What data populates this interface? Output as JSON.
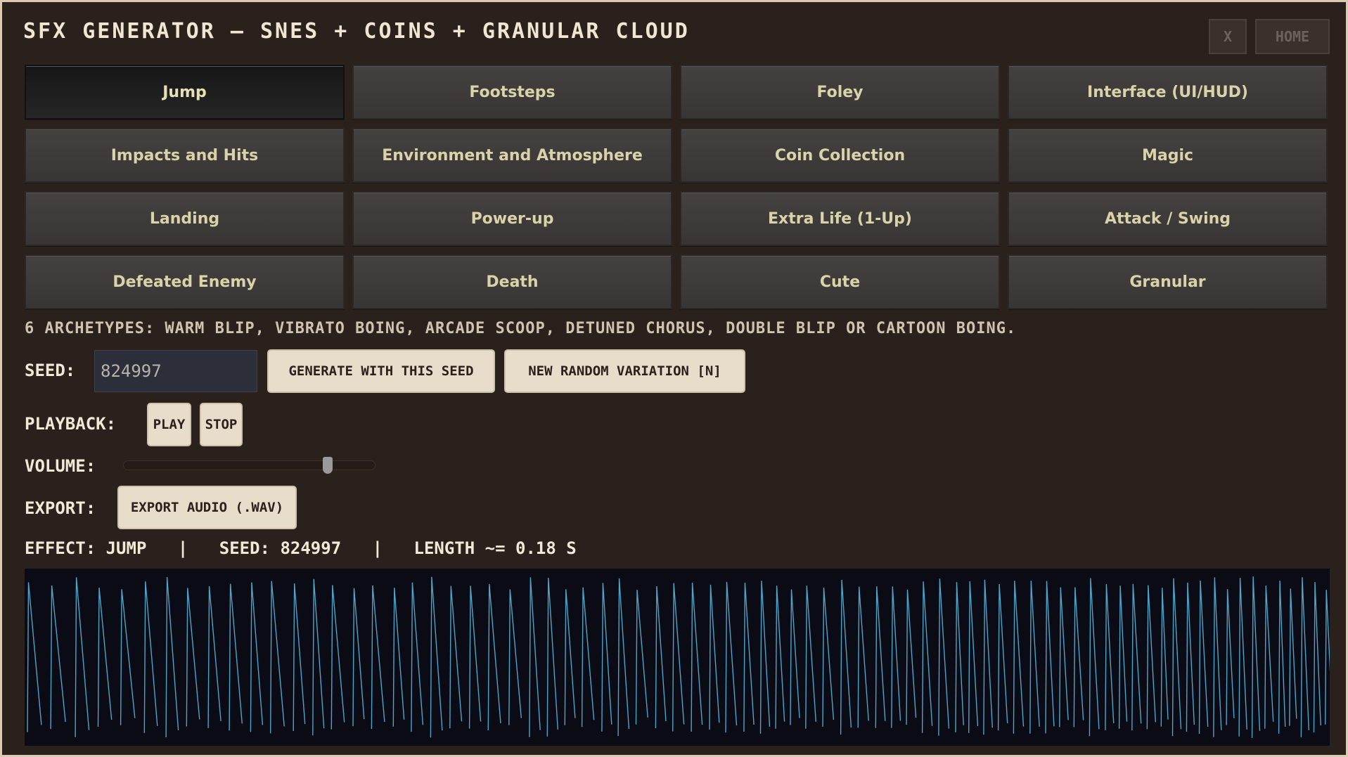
{
  "header": {
    "title": "SFX GENERATOR  –  SNES + COINS + GRANULAR CLOUD",
    "close_label": "X",
    "home_label": "HOME"
  },
  "categories": [
    {
      "label": "Jump",
      "active": true
    },
    {
      "label": "Footsteps"
    },
    {
      "label": "Foley"
    },
    {
      "label": "Interface (UI/HUD)"
    },
    {
      "label": "Impacts and Hits"
    },
    {
      "label": "Environment and Atmosphere"
    },
    {
      "label": "Coin Collection"
    },
    {
      "label": "Magic"
    },
    {
      "label": "Landing"
    },
    {
      "label": "Power-up"
    },
    {
      "label": "Extra Life (1-Up)"
    },
    {
      "label": "Attack / Swing"
    },
    {
      "label": "Defeated Enemy"
    },
    {
      "label": "Death"
    },
    {
      "label": "Cute"
    },
    {
      "label": "Granular"
    }
  ],
  "archetypes_text": "6 ARCHETYPES: WARM BLIP, VIBRATO BOING, ARCADE SCOOP, DETUNED CHORUS, DOUBLE BLIP OR CARTOON BOING.",
  "seed": {
    "label": "SEED:",
    "value": "824997",
    "generate_label": "GENERATE WITH THIS SEED",
    "random_label": "NEW RANDOM VARIATION  [N]"
  },
  "playback": {
    "label": "PLAYBACK:",
    "play_label": "PLAY",
    "stop_label": "STOP"
  },
  "volume": {
    "label": "VOLUME:",
    "level": 0.82
  },
  "export": {
    "label": "EXPORT:",
    "button_label": "EXPORT AUDIO (.WAV)"
  },
  "info": {
    "effect": "EFFECT: JUMP",
    "sep": "|",
    "seed": "SEED: 824997",
    "length": "LENGTH ~= 0.18 S"
  },
  "colors": {
    "background": "#2b211c",
    "waveform": "#5bbfe6",
    "waveform_bg": "#0b0b16",
    "button_text": "#d8d3a8"
  }
}
